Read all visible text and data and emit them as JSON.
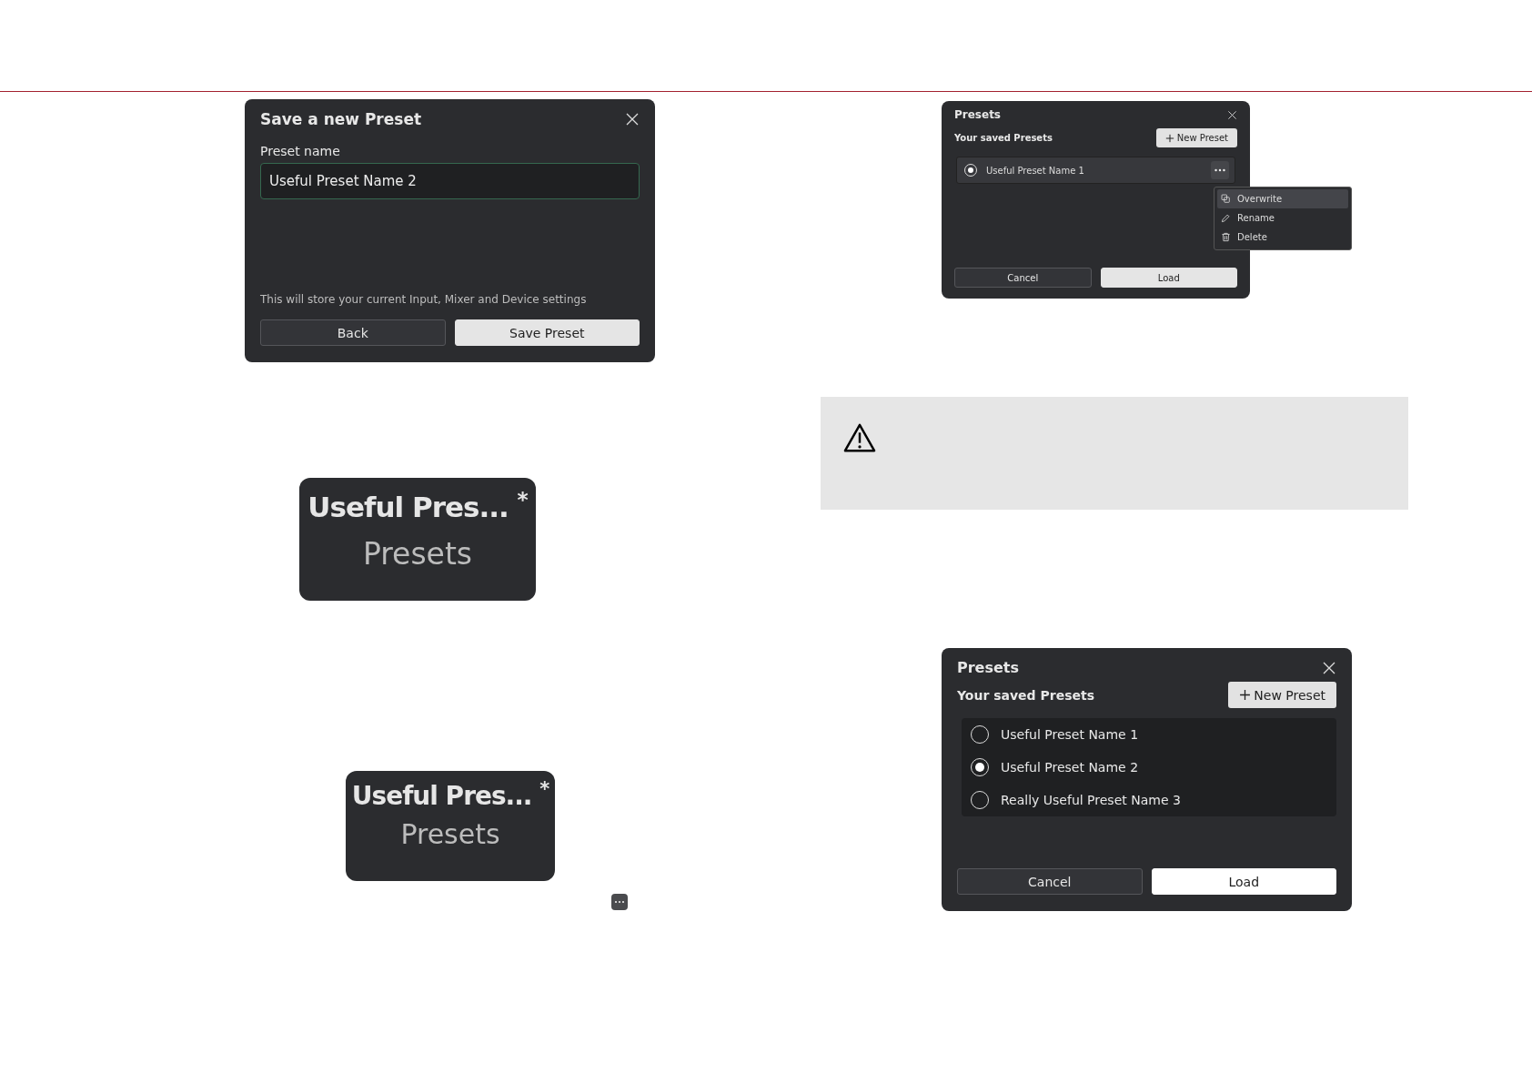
{
  "save_dialog": {
    "title": "Save a new Preset",
    "field_label": "Preset name",
    "field": {
      "value": "Useful Preset Name 2"
    },
    "note": "This will store your current Input, Mixer and Device settings",
    "buttons": [
      {
        "label": "Back",
        "kind": "secondary"
      },
      {
        "label": "Save Preset",
        "kind": "primary"
      }
    ]
  },
  "preset_badges": [
    {
      "title": "Useful Pres... $^{*}$",
      "subtitle": "Presets"
    },
    {
      "title": "Useful Pres... $^{*}$",
      "subtitle": "Presets"
    }
  ],
  "menu_dialog": {
    "title": "Presets",
    "subtitle": "Your saved Presets",
    "new_button": "New Preset",
    "presets": [
      {
        "name": "Useful Preset Name 1",
        "selected": true
      }
    ],
    "menu": [
      {
        "label": "Overwrite",
        "kind": "overwrite",
        "selected": true
      },
      {
        "label": "Rename",
        "kind": "rename",
        "selected": false
      },
      {
        "label": "Delete",
        "kind": "delete",
        "selected": false
      }
    ],
    "buttons": [
      {
        "label": "Cancel",
        "kind": "secondary"
      },
      {
        "label": "Load",
        "kind": "primary"
      }
    ]
  },
  "presets_dialog": {
    "title": "Presets",
    "subtitle": "Your saved Presets",
    "new_button": "New Preset",
    "presets": [
      {
        "name": "Useful Preset Name 1",
        "selected": false
      },
      {
        "name": "Useful Preset Name 2",
        "selected": true
      },
      {
        "name": "Really Useful Preset Name 3",
        "selected": false
      }
    ],
    "buttons": [
      {
        "label": "Cancel",
        "kind": "secondary"
      },
      {
        "label": "Load",
        "kind": "bright"
      }
    ]
  }
}
